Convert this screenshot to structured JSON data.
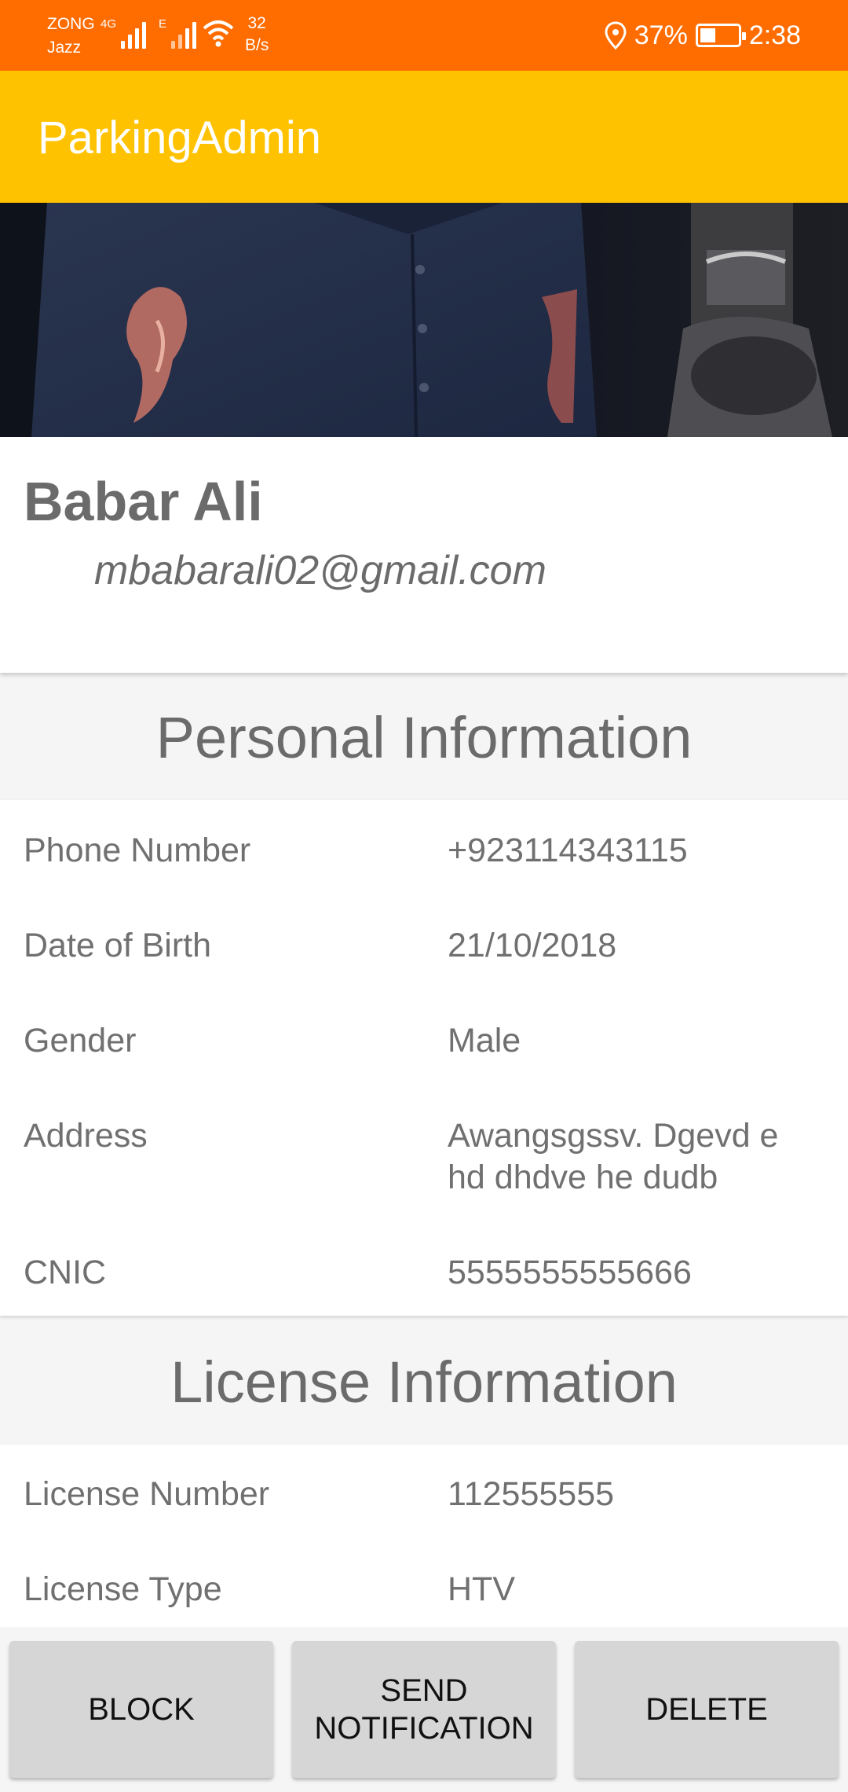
{
  "status_bar": {
    "carrier_top": "ZONG",
    "carrier_bottom": "Jazz",
    "network_1": "4G",
    "network_2": "E",
    "speed_value": "32",
    "speed_unit": "B/s",
    "battery": "37%",
    "time": "2:38"
  },
  "app_bar": {
    "title": "ParkingAdmin"
  },
  "profile": {
    "name": "Babar Ali",
    "email": "mbabarali02@gmail.com"
  },
  "personal": {
    "heading": "Personal Information",
    "rows": [
      {
        "label": "Phone Number",
        "value": "+923114343115"
      },
      {
        "label": "Date of Birth",
        "value": "21/10/2018"
      },
      {
        "label": "Gender",
        "value": "Male"
      },
      {
        "label": "Address",
        "value": "Awangsgssv. Dgevd e hd dhdve he dudb"
      },
      {
        "label": "CNIC",
        "value": "5555555555666"
      }
    ]
  },
  "license": {
    "heading": "License Information",
    "rows": [
      {
        "label": "License Number",
        "value": "112555555"
      },
      {
        "label": "License Type",
        "value": "HTV"
      }
    ]
  },
  "actions": {
    "block": "BLOCK",
    "send_notification": "SEND NOTIFICATION",
    "delete": "DELETE"
  },
  "colors": {
    "status_bar": "#ff6c00",
    "app_bar": "#ffc200",
    "button": "#d6d6d6"
  },
  "icons": [
    "signal-icon",
    "wifi-icon",
    "location-pin-icon",
    "battery-icon"
  ]
}
